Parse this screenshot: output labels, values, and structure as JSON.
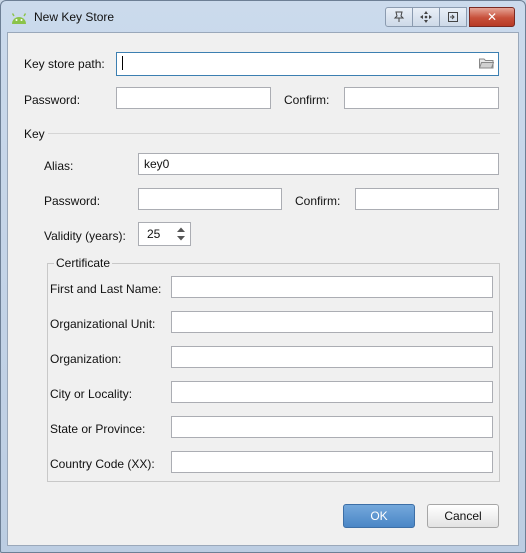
{
  "window": {
    "title": "New Key Store",
    "title_buttons": [
      "pin-icon",
      "move-icon",
      "restore-icon",
      "close-icon"
    ]
  },
  "keystore": {
    "path_label": "Key store path:",
    "path_value": "",
    "password_label": "Password:",
    "confirm_label": "Confirm:"
  },
  "key": {
    "section_label": "Key",
    "alias_label": "Alias:",
    "alias_value": "key0",
    "password_label": "Password:",
    "confirm_label": "Confirm:",
    "validity_label": "Validity (years):",
    "validity_value": "25"
  },
  "certificate": {
    "legend": "Certificate",
    "fields": [
      {
        "label": "First and Last Name:",
        "value": ""
      },
      {
        "label": "Organizational Unit:",
        "value": ""
      },
      {
        "label": "Organization:",
        "value": ""
      },
      {
        "label": "City or Locality:",
        "value": ""
      },
      {
        "label": "State or Province:",
        "value": ""
      },
      {
        "label": "Country Code (XX):",
        "value": ""
      }
    ]
  },
  "buttons": {
    "ok": "OK",
    "cancel": "Cancel"
  },
  "colors": {
    "ok_button": "#4a86c6",
    "close_button": "#c7503a",
    "focus_border": "#3c7fb1"
  }
}
